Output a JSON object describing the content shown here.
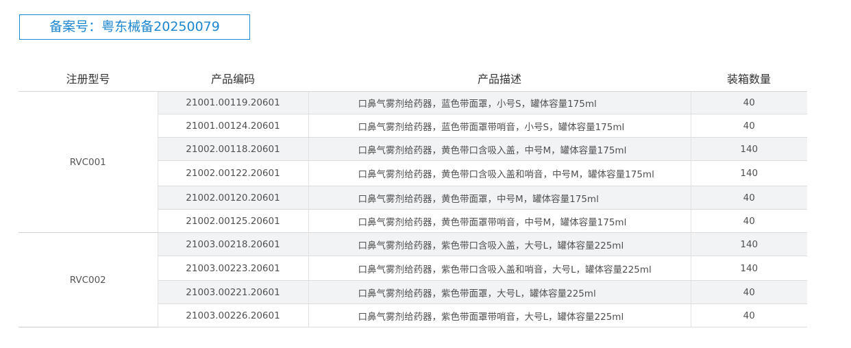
{
  "badge": {
    "text": "备案号：粤东械备20250079"
  },
  "table": {
    "headers": [
      "注册型号",
      "产品编码",
      "产品描述",
      "装箱数量"
    ],
    "groups": [
      {
        "model": "RVC001",
        "rows": [
          {
            "code": "21001.00119.20601",
            "desc": "口鼻气雾剂给药器，蓝色带面罩，小号S，罐体容量175ml",
            "qty": "40"
          },
          {
            "code": "21001.00124.20601",
            "desc": "口鼻气雾剂给药器，蓝色带面罩带哨音，小号S，罐体容量175ml",
            "qty": "40"
          },
          {
            "code": "21002.00118.20601",
            "desc": "口鼻气雾剂给药器，黄色带口含吸入盖，中号M，罐体容量175ml",
            "qty": "140"
          },
          {
            "code": "21002.00122.20601",
            "desc": "口鼻气雾剂给药器，黄色带口含吸入盖和哨音，中号M，罐体容量175ml",
            "qty": "140"
          },
          {
            "code": "21002.00120.20601",
            "desc": "口鼻气雾剂给药器，黄色带面罩，中号M，罐体容量175ml",
            "qty": "40"
          },
          {
            "code": "21002.00125.20601",
            "desc": "口鼻气雾剂给药器，黄色带面罩带哨音，中号M，罐体容量175ml",
            "qty": "40"
          }
        ]
      },
      {
        "model": "RVC002",
        "rows": [
          {
            "code": "21003.00218.20601",
            "desc": "口鼻气雾剂给药器，紫色带口含吸入盖，大号L，罐体容量225ml",
            "qty": "140"
          },
          {
            "code": "21003.00223.20601",
            "desc": "口鼻气雾剂给药器，紫色带口含吸入盖和哨音，大号L，罐体容量225ml",
            "qty": "140"
          },
          {
            "code": "21003.00221.20601",
            "desc": "口鼻气雾剂给药器，紫色带面罩，大号L，罐体容量225ml",
            "qty": "40"
          },
          {
            "code": "21003.00226.20601",
            "desc": "口鼻气雾剂给药器，紫色带面罩带哨音，大号L，罐体容量225ml",
            "qty": "40"
          }
        ]
      }
    ]
  },
  "colors": {
    "accent": "#1c86d1",
    "row_shade": "#f2f3f5"
  }
}
